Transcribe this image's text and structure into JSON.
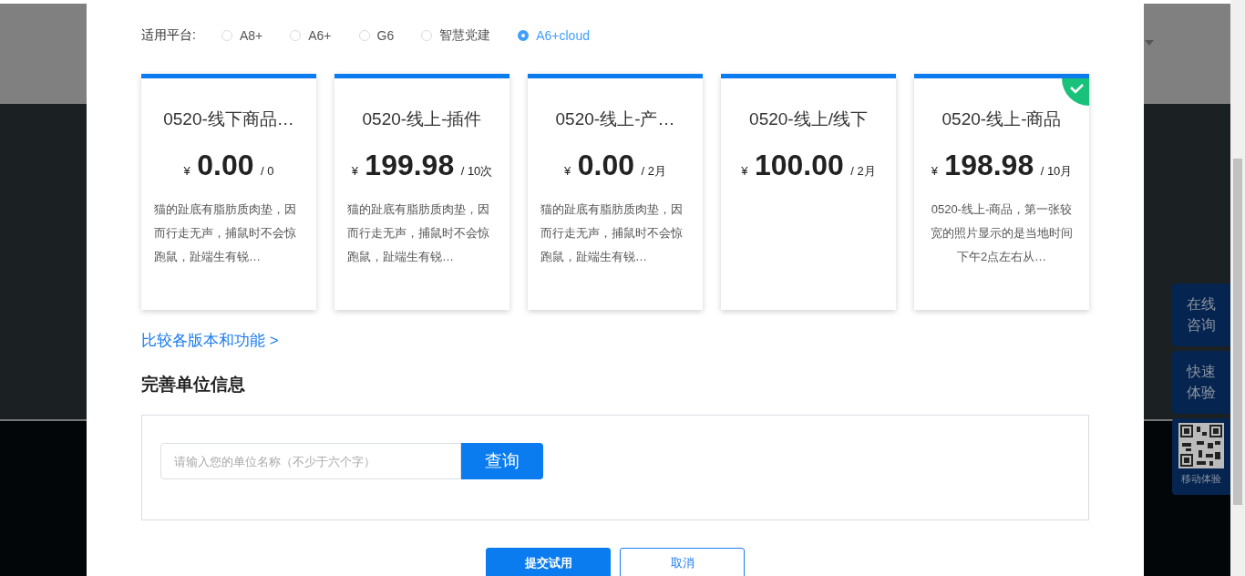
{
  "platform": {
    "label": "适用平台:",
    "options": [
      {
        "label": "A8+",
        "selected": false
      },
      {
        "label": "A6+",
        "selected": false
      },
      {
        "label": "G6",
        "selected": false
      },
      {
        "label": "智慧党建",
        "selected": false
      },
      {
        "label": "A6+cloud",
        "selected": true
      }
    ]
  },
  "plans": [
    {
      "name": "0520-线下商品…",
      "currency": "¥",
      "price": "0.00",
      "unit": "/ 0",
      "description": "猫的趾底有脂肪质肉垫，因而行走无声，捕鼠时不会惊跑鼠，趾端生有锐…",
      "selected": false
    },
    {
      "name": "0520-线上-插件",
      "currency": "¥",
      "price": "199.98",
      "unit": "/ 10次",
      "description": "猫的趾底有脂肪质肉垫，因而行走无声，捕鼠时不会惊跑鼠，趾端生有锐…",
      "selected": false
    },
    {
      "name": "0520-线上-产…",
      "currency": "¥",
      "price": "0.00",
      "unit": "/ 2月",
      "description": "猫的趾底有脂肪质肉垫，因而行走无声，捕鼠时不会惊跑鼠，趾端生有锐…",
      "selected": false
    },
    {
      "name": "0520-线上/线下",
      "currency": "¥",
      "price": "100.00",
      "unit": "/ 2月",
      "selected": false
    },
    {
      "name": "0520-线上-商品",
      "currency": "¥",
      "price": "198.98",
      "unit": "/ 10月",
      "description": "0520-线上-商品，第一张较宽的照片显示的是当地时间下午2点左右从…",
      "selected": true
    }
  ],
  "compare_link": "比较各版本和功能 >",
  "section_title": "完善单位信息",
  "company_search": {
    "placeholder": "请输入您的单位名称（不少于六个字）",
    "button": "查询"
  },
  "actions": {
    "submit": "提交试用",
    "cancel": "取消"
  },
  "side_buttons": [
    {
      "kind": "text",
      "label": "在线咨询"
    },
    {
      "kind": "text",
      "label": "快速体验"
    },
    {
      "kind": "qr",
      "label": "移动体验"
    }
  ]
}
